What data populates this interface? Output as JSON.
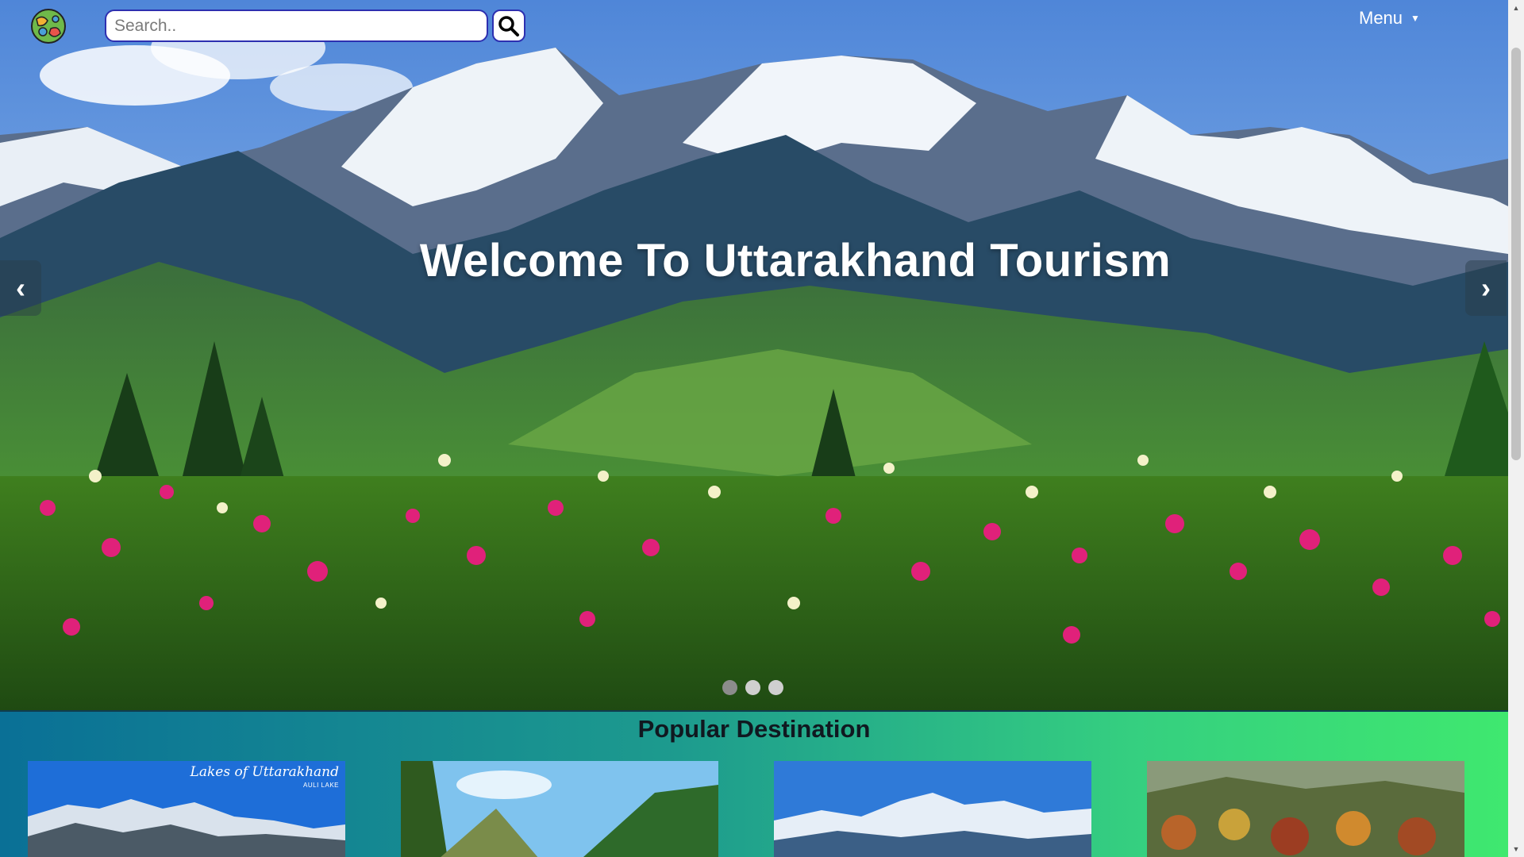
{
  "header": {
    "search_placeholder": "Search..",
    "menu_label": "Menu",
    "menu_caret": "▼"
  },
  "hero": {
    "title": "Welcome To Uttarakhand Tourism",
    "prev_label": "‹",
    "next_label": "›",
    "slide_count": 3,
    "active_slide": 1
  },
  "popular": {
    "title": "Popular Destination",
    "cards": [
      {
        "caption": "Lakes of Uttarakhand",
        "subcaption": "AULI LAKE"
      },
      {
        "caption": "",
        "subcaption": ""
      },
      {
        "caption": "",
        "subcaption": ""
      },
      {
        "caption": "",
        "subcaption": ""
      }
    ]
  },
  "colors": {
    "search_border": "#2d2fb0",
    "popular_gradient_start": "#0a7096",
    "popular_gradient_end": "#3fe86f"
  },
  "icons": {
    "logo": "globe-logo-icon",
    "search": "search-icon",
    "prev": "chevron-left-icon",
    "next": "chevron-right-icon"
  }
}
